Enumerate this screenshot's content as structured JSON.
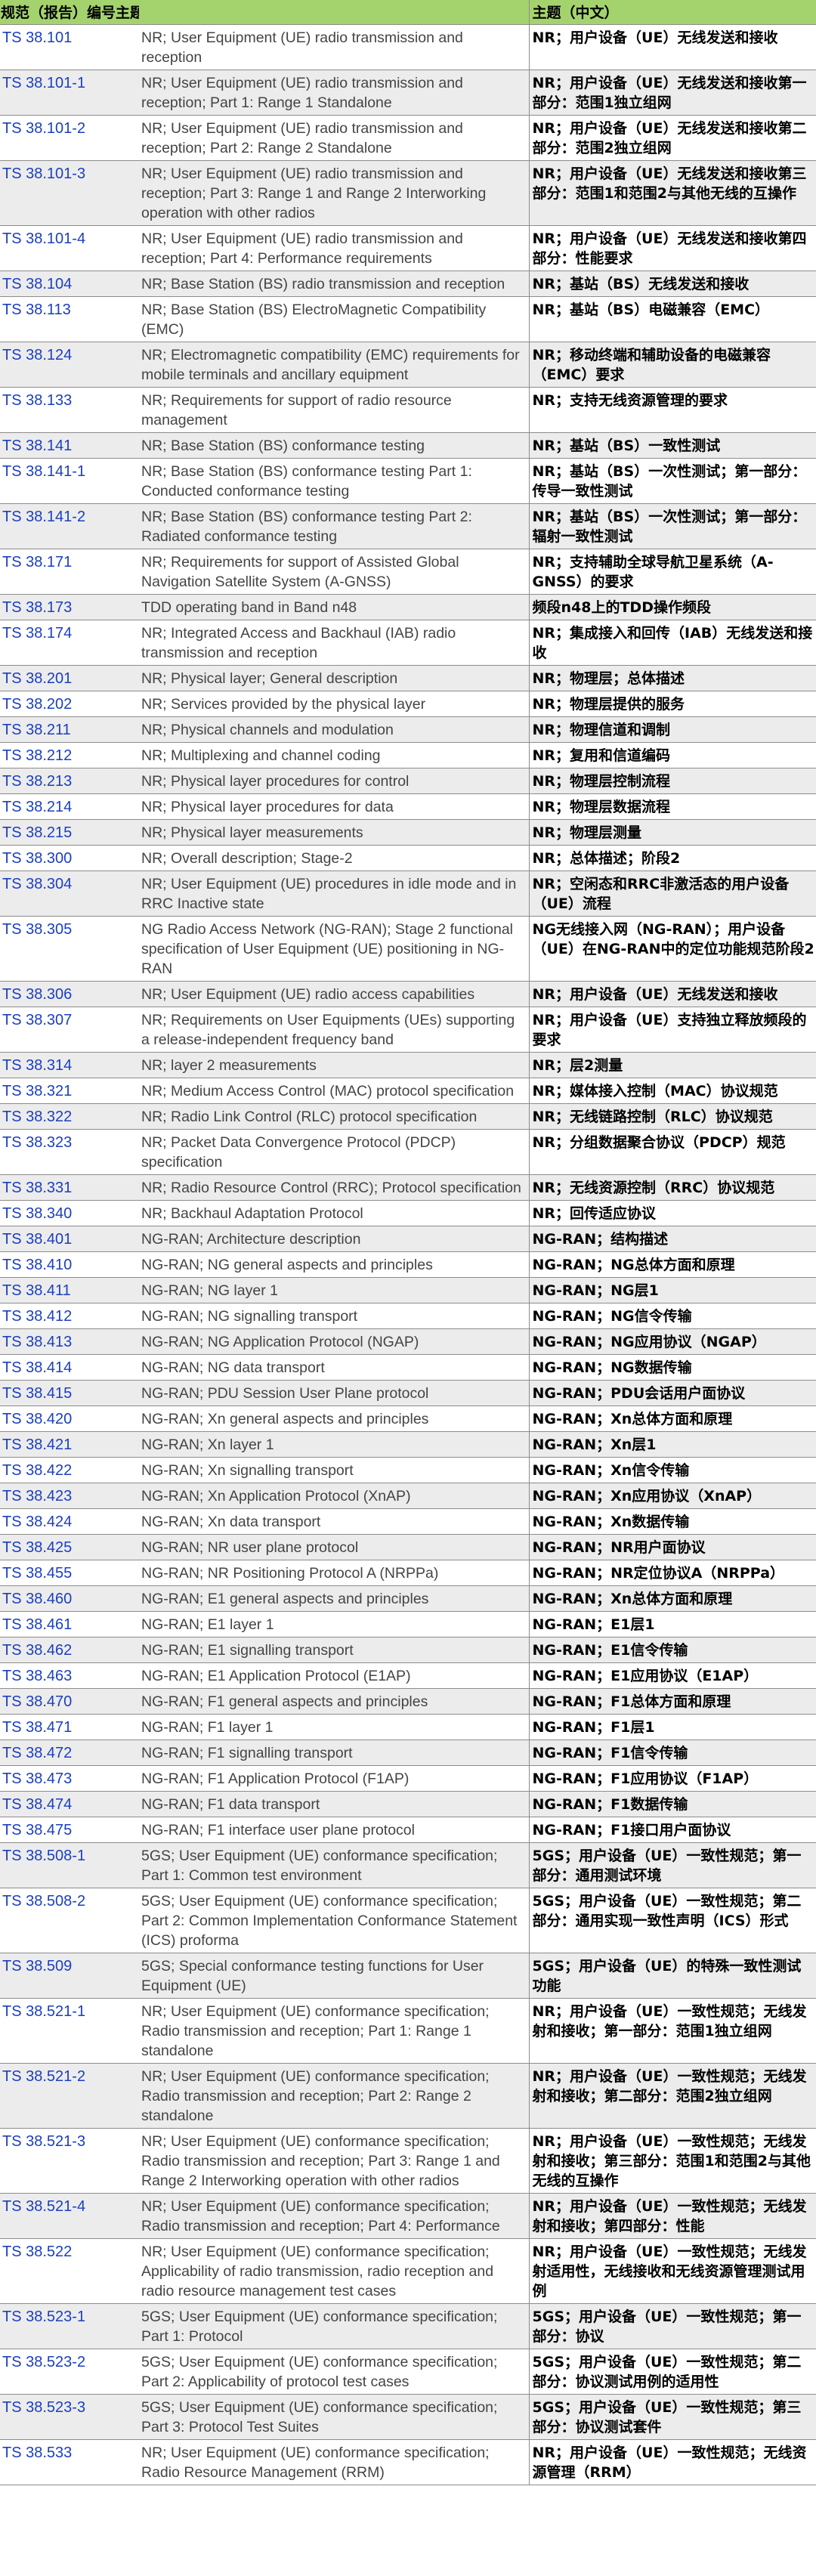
{
  "header": {
    "col_id": "规范（报告）编号",
    "col_en": "主题（英文）",
    "col_zh": "主题（中文）"
  },
  "rows": [
    {
      "id": "TS 38.101",
      "en": "NR; User Equipment (UE) radio transmission and reception",
      "zh": "NR；用户设备（UE）无线发送和接收"
    },
    {
      "id": "TS 38.101-1",
      "en": "NR; User Equipment (UE) radio transmission and reception; Part 1: Range 1 Standalone",
      "zh": "NR；用户设备（UE）无线发送和接收第一部分：范围1独立组网"
    },
    {
      "id": "TS 38.101-2",
      "en": "NR; User Equipment (UE) radio transmission and reception; Part 2: Range 2 Standalone",
      "zh": "NR；用户设备（UE）无线发送和接收第二部分：范围2独立组网"
    },
    {
      "id": "TS 38.101-3",
      "en": "NR; User Equipment (UE) radio transmission and reception; Part 3: Range 1 and Range 2 Interworking operation with other radios",
      "zh": "NR；用户设备（UE）无线发送和接收第三部分：范围1和范围2与其他无线的互操作"
    },
    {
      "id": "TS 38.101-4",
      "en": "NR; User Equipment (UE) radio transmission and reception; Part 4: Performance requirements",
      "zh": "NR；用户设备（UE）无线发送和接收第四部分：性能要求"
    },
    {
      "id": "TS 38.104",
      "en": "NR; Base Station (BS) radio transmission and reception",
      "zh": "NR；基站（BS）无线发送和接收"
    },
    {
      "id": "TS 38.113",
      "en": "NR; Base Station (BS) ElectroMagnetic Compatibility (EMC)",
      "zh": "NR；基站（BS）电磁兼容（EMC）"
    },
    {
      "id": "TS 38.124",
      "en": "NR; Electromagnetic compatibility (EMC) requirements for mobile terminals and ancillary equipment",
      "zh": "NR；移动终端和辅助设备的电磁兼容（EMC）要求"
    },
    {
      "id": "TS 38.133",
      "en": "NR; Requirements for support of radio resource management",
      "zh": "NR；支持无线资源管理的要求"
    },
    {
      "id": "TS 38.141",
      "en": "NR; Base Station (BS) conformance testing",
      "zh": "NR；基站（BS）一致性测试"
    },
    {
      "id": "TS 38.141-1",
      "en": "NR; Base Station (BS) conformance testing Part 1: Conducted conformance testing",
      "zh": "NR；基站（BS）一次性测试；第一部分：传导一致性测试"
    },
    {
      "id": "TS 38.141-2",
      "en": "NR; Base Station (BS) conformance testing Part 2: Radiated conformance testing",
      "zh": "NR；基站（BS）一次性测试；第一部分：辐射一致性测试"
    },
    {
      "id": "TS 38.171",
      "en": "NR; Requirements for support of Assisted Global Navigation Satellite System (A-GNSS)",
      "zh": "NR；支持辅助全球导航卫星系统（A-GNSS）的要求"
    },
    {
      "id": "TS 38.173",
      "en": "TDD operating band in Band n48",
      "zh": "频段n48上的TDD操作频段"
    },
    {
      "id": "TS 38.174",
      "en": "NR; Integrated Access and Backhaul (IAB) radio transmission and reception",
      "zh": "NR；集成接入和回传（IAB）无线发送和接收"
    },
    {
      "id": "TS 38.201",
      "en": "NR; Physical layer; General description",
      "zh": "NR；物理层；总体描述"
    },
    {
      "id": "TS 38.202",
      "en": "NR; Services provided by the physical layer",
      "zh": "NR；物理层提供的服务"
    },
    {
      "id": "TS 38.211",
      "en": "NR; Physical channels and modulation",
      "zh": "NR；物理信道和调制"
    },
    {
      "id": "TS 38.212",
      "en": "NR; Multiplexing and channel coding",
      "zh": "NR；复用和信道编码"
    },
    {
      "id": "TS 38.213",
      "en": "NR; Physical layer procedures for control",
      "zh": "NR；物理层控制流程"
    },
    {
      "id": "TS 38.214",
      "en": "NR; Physical layer procedures for data",
      "zh": "NR；物理层数据流程"
    },
    {
      "id": "TS 38.215",
      "en": "NR; Physical layer measurements",
      "zh": "NR；物理层测量"
    },
    {
      "id": "TS 38.300",
      "en": "NR; Overall description; Stage-2",
      "zh": "NR；总体描述；阶段2"
    },
    {
      "id": "TS 38.304",
      "en": "NR; User Equipment (UE) procedures in idle mode and in RRC Inactive state",
      "zh": "NR；空闲态和RRC非激活态的用户设备（UE）流程"
    },
    {
      "id": "TS 38.305",
      "en": "NG Radio Access Network (NG-RAN); Stage 2 functional specification of User Equipment (UE) positioning in NG-RAN",
      "zh": "NG无线接入网（NG-RAN）；用户设备（UE）在NG-RAN中的定位功能规范阶段2"
    },
    {
      "id": "TS 38.306",
      "en": "NR; User Equipment (UE) radio access capabilities",
      "zh": "NR；用户设备（UE）无线发送和接收"
    },
    {
      "id": "TS 38.307",
      "en": "NR; Requirements on User Equipments (UEs) supporting a release-independent frequency band",
      "zh": "NR；用户设备（UE）支持独立释放频段的要求"
    },
    {
      "id": "TS 38.314",
      "en": "NR; layer 2 measurements",
      "zh": "NR；层2测量"
    },
    {
      "id": "TS 38.321",
      "en": "NR; Medium Access Control (MAC) protocol specification",
      "zh": "NR；媒体接入控制（MAC）协议规范"
    },
    {
      "id": "TS 38.322",
      "en": "NR; Radio Link Control (RLC) protocol specification",
      "zh": "NR；无线链路控制（RLC）协议规范"
    },
    {
      "id": "TS 38.323",
      "en": "NR; Packet Data Convergence Protocol (PDCP) specification",
      "zh": "NR；分组数据聚合协议（PDCP）规范"
    },
    {
      "id": "TS 38.331",
      "en": "NR; Radio Resource Control (RRC); Protocol specification",
      "zh": "NR；无线资源控制（RRC）协议规范"
    },
    {
      "id": "TS 38.340",
      "en": "NR; Backhaul Adaptation Protocol",
      "zh": "NR；回传适应协议"
    },
    {
      "id": "TS 38.401",
      "en": "NG-RAN; Architecture description",
      "zh": "NG-RAN；结构描述"
    },
    {
      "id": "TS 38.410",
      "en": "NG-RAN; NG general aspects and principles",
      "zh": "NG-RAN；NG总体方面和原理"
    },
    {
      "id": "TS 38.411",
      "en": "NG-RAN; NG layer 1",
      "zh": "NG-RAN；NG层1"
    },
    {
      "id": "TS 38.412",
      "en": "NG-RAN; NG signalling transport",
      "zh": "NG-RAN；NG信令传输"
    },
    {
      "id": "TS 38.413",
      "en": "NG-RAN; NG Application Protocol (NGAP)",
      "zh": "NG-RAN；NG应用协议（NGAP）"
    },
    {
      "id": "TS 38.414",
      "en": "NG-RAN; NG data transport",
      "zh": "NG-RAN；NG数据传输"
    },
    {
      "id": "TS 38.415",
      "en": "NG-RAN; PDU Session User Plane protocol",
      "zh": "NG-RAN；PDU会话用户面协议"
    },
    {
      "id": "TS 38.420",
      "en": "NG-RAN; Xn general aspects and principles",
      "zh": "NG-RAN；Xn总体方面和原理"
    },
    {
      "id": "TS 38.421",
      "en": "NG-RAN; Xn layer 1",
      "zh": "NG-RAN；Xn层1"
    },
    {
      "id": "TS 38.422",
      "en": "NG-RAN; Xn signalling transport",
      "zh": "NG-RAN；Xn信令传输"
    },
    {
      "id": "TS 38.423",
      "en": "NG-RAN; Xn Application Protocol (XnAP)",
      "zh": "NG-RAN；Xn应用协议（XnAP）"
    },
    {
      "id": "TS 38.424",
      "en": "NG-RAN; Xn data transport",
      "zh": "NG-RAN；Xn数据传输"
    },
    {
      "id": "TS 38.425",
      "en": "NG-RAN; NR user plane protocol",
      "zh": "NG-RAN；NR用户面协议"
    },
    {
      "id": "TS 38.455",
      "en": "NG-RAN; NR Positioning Protocol A (NRPPa)",
      "zh": "NG-RAN；NR定位协议A（NRPPa）"
    },
    {
      "id": "TS 38.460",
      "en": "NG-RAN; E1 general aspects and principles",
      "zh": "NG-RAN；Xn总体方面和原理"
    },
    {
      "id": "TS 38.461",
      "en": "NG-RAN; E1 layer 1",
      "zh": "NG-RAN；E1层1"
    },
    {
      "id": "TS 38.462",
      "en": "NG-RAN; E1 signalling transport",
      "zh": "NG-RAN；E1信令传输"
    },
    {
      "id": "TS 38.463",
      "en": "NG-RAN; E1 Application Protocol (E1AP)",
      "zh": "NG-RAN；E1应用协议（E1AP）"
    },
    {
      "id": "TS 38.470",
      "en": "NG-RAN; F1 general aspects and principles",
      "zh": "NG-RAN；F1总体方面和原理"
    },
    {
      "id": "TS 38.471",
      "en": "NG-RAN; F1 layer 1",
      "zh": "NG-RAN；F1层1"
    },
    {
      "id": "TS 38.472",
      "en": "NG-RAN; F1 signalling transport",
      "zh": "NG-RAN；F1信令传输"
    },
    {
      "id": "TS 38.473",
      "en": "NG-RAN; F1 Application Protocol (F1AP)",
      "zh": "NG-RAN；F1应用协议（F1AP）"
    },
    {
      "id": "TS 38.474",
      "en": "NG-RAN; F1 data transport",
      "zh": "NG-RAN；F1数据传输"
    },
    {
      "id": "TS 38.475",
      "en": "NG-RAN; F1 interface user plane protocol",
      "zh": "NG-RAN；F1接口用户面协议"
    },
    {
      "id": "TS 38.508-1",
      "en": "5GS; User Equipment (UE) conformance specification; Part 1: Common test environment",
      "zh": "5GS；用户设备（UE）一致性规范；第一部分：通用测试环境"
    },
    {
      "id": "TS 38.508-2",
      "en": "5GS; User Equipment (UE) conformance specification; Part 2: Common Implementation Conformance Statement (ICS) proforma",
      "zh": "5GS；用户设备（UE）一致性规范；第二部分：通用实现一致性声明（ICS）形式"
    },
    {
      "id": "TS 38.509",
      "en": "5GS; Special conformance testing functions for User Equipment (UE)",
      "zh": "5GS；用户设备（UE）的特殊一致性测试功能"
    },
    {
      "id": "TS 38.521-1",
      "en": "NR; User Equipment (UE) conformance specification; Radio transmission and reception; Part 1: Range 1 standalone",
      "zh": "NR；用户设备（UE）一致性规范；无线发射和接收；第一部分：范围1独立组网"
    },
    {
      "id": "TS 38.521-2",
      "en": "NR; User Equipment (UE) conformance specification; Radio transmission and reception; Part 2: Range 2 standalone",
      "zh": "NR；用户设备（UE）一致性规范；无线发射和接收；第二部分：范围2独立组网"
    },
    {
      "id": "TS 38.521-3",
      "en": "NR; User Equipment (UE) conformance specification; Radio transmission and reception; Part 3: Range 1 and Range 2 Interworking operation with other radios",
      "zh": "NR；用户设备（UE）一致性规范；无线发射和接收；第三部分：范围1和范围2与其他无线的互操作"
    },
    {
      "id": "TS 38.521-4",
      "en": "NR; User Equipment (UE) conformance specification; Radio transmission and reception; Part 4: Performance",
      "zh": "NR；用户设备（UE）一致性规范；无线发射和接收；第四部分：性能"
    },
    {
      "id": "TS 38.522",
      "en": "NR; User Equipment (UE) conformance specification; Applicability of radio transmission, radio reception and radio resource management test cases",
      "zh": "NR；用户设备（UE）一致性规范；无线发射适用性，无线接收和无线资源管理测试用例"
    },
    {
      "id": "TS 38.523-1",
      "en": "5GS; User Equipment (UE) conformance specification; Part 1: Protocol",
      "zh": "5GS；用户设备（UE）一致性规范；第一部分：协议"
    },
    {
      "id": "TS 38.523-2",
      "en": "5GS; User Equipment (UE) conformance specification; Part 2: Applicability of protocol test cases",
      "zh": "5GS；用户设备（UE）一致性规范；第二部分：协议测试用例的适用性"
    },
    {
      "id": "TS 38.523-3",
      "en": "5GS; User Equipment (UE) conformance specification; Part 3: Protocol Test Suites",
      "zh": "5GS；用户设备（UE）一致性规范；第三部分：协议测试套件"
    },
    {
      "id": "TS 38.533",
      "en": "NR; User Equipment (UE) conformance specification; Radio Resource Management (RRM)",
      "zh": "NR；用户设备（UE）一致性规范；无线资源管理（RRM）"
    }
  ]
}
